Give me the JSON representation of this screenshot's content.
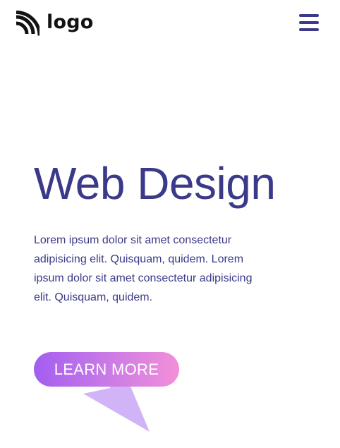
{
  "header": {
    "logo_text": "logo"
  },
  "hero": {
    "title": "Web Design",
    "description": "Lorem ipsum dolor sit amet consectetur adipisicing elit. Quisquam, quidem. Lorem ipsum dolor sit amet consectetur adipisicing elit. Quisquam, quidem.",
    "cta_label": "LEARN MORE"
  },
  "colors": {
    "brand": "#3b3a8a",
    "logo": "#121212",
    "gradient_start": "#a35ef0",
    "gradient_end": "#f38fd8",
    "decoration": "#c9a6f7"
  },
  "icons": {
    "logo_mark": "feed-arcs-icon",
    "menu": "hamburger-menu-icon",
    "decoration": "arrow-decoration-icon"
  }
}
